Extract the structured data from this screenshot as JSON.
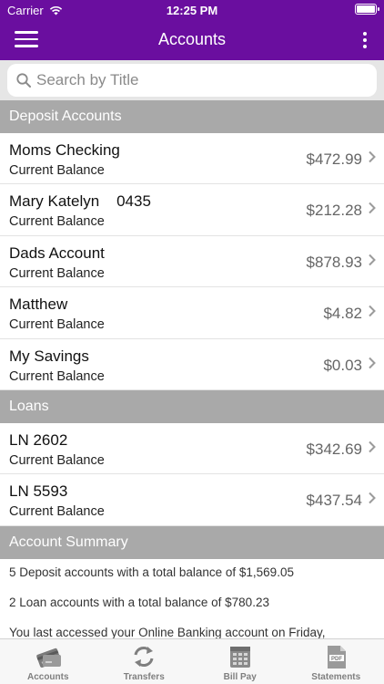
{
  "status_bar": {
    "carrier": "Carrier",
    "time": "12:25 PM"
  },
  "nav": {
    "title": "Accounts"
  },
  "search": {
    "placeholder": "Search by Title",
    "value": ""
  },
  "deposit_section": {
    "title": "Deposit Accounts",
    "accounts": [
      {
        "name": "Moms Checking",
        "subtitle": "Current Balance",
        "amount": "$472.99"
      },
      {
        "name": "Mary Katelyn    0435",
        "subtitle": "Current Balance",
        "amount": "$212.28"
      },
      {
        "name": "Dads Account",
        "subtitle": "Current Balance",
        "amount": "$878.93"
      },
      {
        "name": "Matthew",
        "subtitle": "Current Balance",
        "amount": "$4.82"
      },
      {
        "name": "My Savings",
        "subtitle": "Current Balance",
        "amount": "$0.03"
      }
    ]
  },
  "loans_section": {
    "title": "Loans",
    "accounts": [
      {
        "name": "LN 2602",
        "subtitle": "Current Balance",
        "amount": "$342.69"
      },
      {
        "name": "LN 5593",
        "subtitle": "Current Balance",
        "amount": "$437.54"
      }
    ]
  },
  "summary_section": {
    "title": "Account Summary",
    "lines": [
      "5 Deposit accounts with a total balance of $1,569.05",
      "2 Loan accounts with a total balance of $780.23",
      "You last accessed your Online Banking account on Friday,"
    ]
  },
  "tabbar": {
    "tabs": [
      {
        "label": "Accounts",
        "icon": "accounts-card-icon"
      },
      {
        "label": "Transfers",
        "icon": "transfers-arrows-icon"
      },
      {
        "label": "Bill Pay",
        "icon": "calendar-icon"
      },
      {
        "label": "Statements",
        "icon": "pdf-document-icon"
      }
    ]
  },
  "colors": {
    "brand_purple": "#6a0e9f",
    "section_gray": "#a9a9a9",
    "search_bg": "#e6e6e6"
  }
}
